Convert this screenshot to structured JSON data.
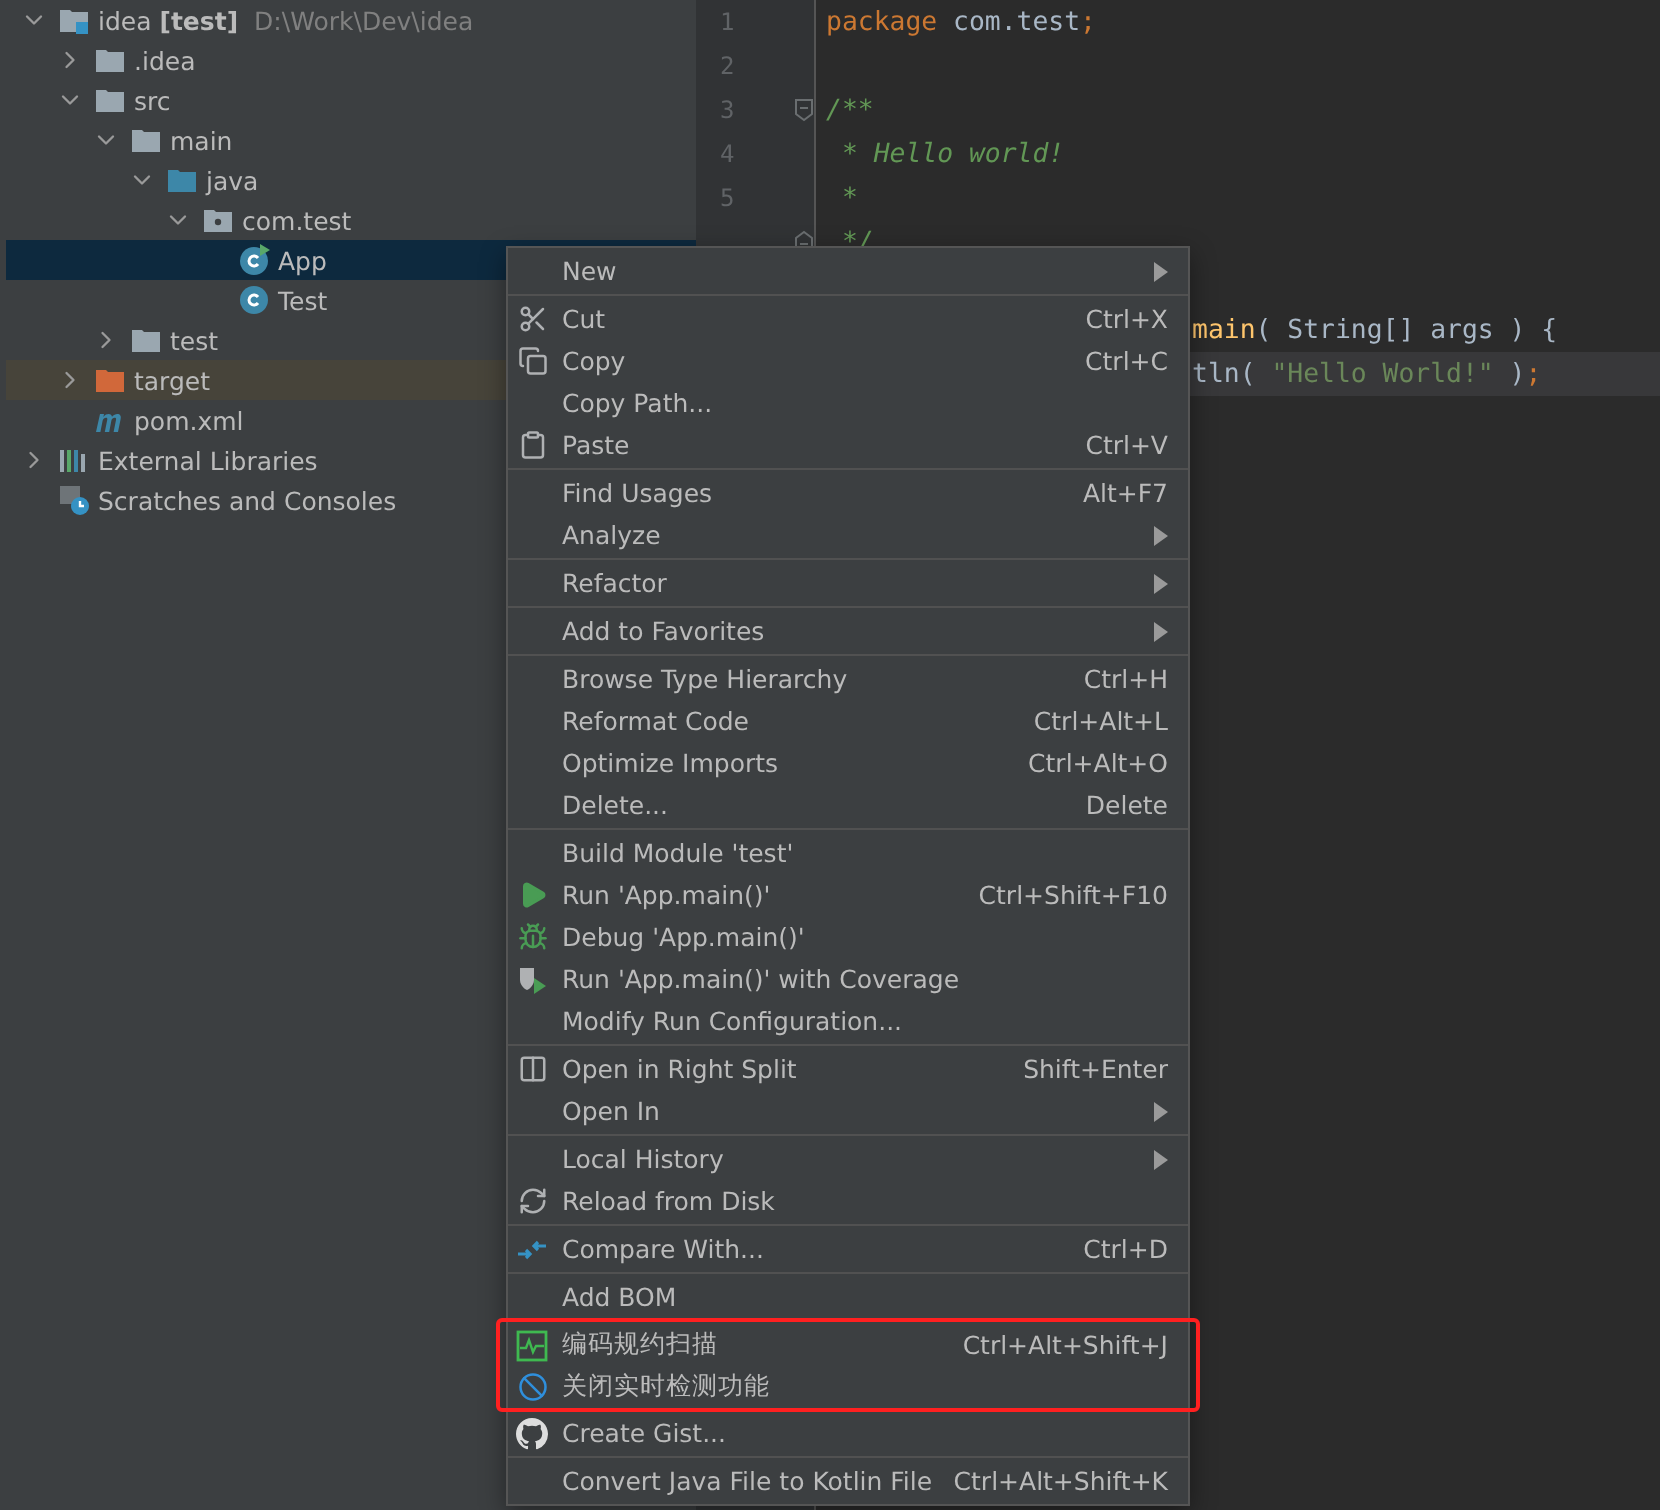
{
  "project_tree": [
    {
      "label": "idea **[test]**",
      "path": "D:\\Work\\Dev\\idea",
      "kind": "module",
      "expanded": true,
      "selected": false,
      "children": [
        {
          "label": ".idea",
          "kind": "folder",
          "expanded": false,
          "selected": false
        },
        {
          "label": "src",
          "kind": "folder",
          "expanded": true,
          "selected": false,
          "children": [
            {
              "label": "main",
              "kind": "folder",
              "expanded": true,
              "selected": false,
              "children": [
                {
                  "label": "java",
                  "kind": "source",
                  "expanded": true,
                  "selected": false,
                  "children": [
                    {
                      "label": "com.test",
                      "kind": "package",
                      "expanded": true,
                      "selected": false,
                      "children": [
                        {
                          "label": "App",
                          "kind": "main",
                          "selected": true
                        },
                        {
                          "label": "Test",
                          "kind": "class",
                          "selected": false
                        }
                      ]
                    }
                  ]
                }
              ]
            },
            {
              "label": "test",
              "kind": "folder",
              "expanded": false,
              "selected": false
            }
          ]
        },
        {
          "label": "target",
          "kind": "excluded",
          "expanded": false,
          "selected": false
        },
        {
          "label": "pom.xml",
          "kind": "maven",
          "selected": false
        }
      ]
    },
    {
      "label": "External Libraries",
      "kind": "libraries",
      "expanded": false,
      "selected": false
    },
    {
      "label": "Scratches and Consoles",
      "kind": "scratches",
      "selected": false
    }
  ],
  "editor": {
    "lines": [
      {
        "number": "1",
        "kind": "code",
        "current": false,
        "segments": [
          {
            "text": "package",
            "kind": "keyword"
          },
          {
            "text": " com.test",
            "kind": "plain"
          },
          {
            "text": ";",
            "kind": "keyword"
          }
        ]
      },
      {
        "number": "2",
        "kind": "blank",
        "current": false
      },
      {
        "number": "3",
        "kind": "foldstart",
        "current": false,
        "segments": [
          {
            "text": "/**",
            "kind": "doc"
          }
        ]
      },
      {
        "number": "4",
        "kind": "code",
        "current": false,
        "segments": [
          {
            "text": " * Hello world!",
            "kind": "doc"
          }
        ]
      },
      {
        "number": "5",
        "kind": "code",
        "current": false,
        "segments": [
          {
            "text": " *",
            "kind": "doc"
          }
        ]
      },
      {
        "kind": "foldend",
        "current": false,
        "segments": [
          {
            "text": " */",
            "kind": "doc"
          }
        ]
      },
      {
        "kind": "blank",
        "current": false
      },
      {
        "kind": "partial",
        "current": false,
        "segments": [
          {
            "text": "main",
            "kind": "method"
          },
          {
            "text": "( String[] args ) {",
            "kind": "plain"
          }
        ]
      },
      {
        "kind": "partial",
        "current": true,
        "segments": [
          {
            "text": "tln( ",
            "kind": "plain"
          },
          {
            "text": "\"Hello World!\"",
            "kind": "string"
          },
          {
            "text": " )",
            "kind": "plain"
          },
          {
            "text": ";",
            "kind": "keyword"
          }
        ]
      }
    ]
  },
  "context_menu": {
    "groups": [
      {
        "divider": false,
        "outlined": false,
        "items": [
          {
            "label": "New",
            "submenu": true
          }
        ]
      },
      {
        "divider": true,
        "outlined": false,
        "items": [
          {
            "label": "Cut",
            "kind": "scissors",
            "shortcut": "Ctrl+X",
            "submenu": false
          },
          {
            "label": "Copy",
            "kind": "copy",
            "shortcut": "Ctrl+C",
            "submenu": false
          },
          {
            "label": "Copy Path...",
            "submenu": false
          },
          {
            "label": "Paste",
            "kind": "clipboard",
            "shortcut": "Ctrl+V",
            "submenu": false
          }
        ]
      },
      {
        "divider": true,
        "outlined": false,
        "items": [
          {
            "label": "Find Usages",
            "shortcut": "Alt+F7",
            "submenu": false
          },
          {
            "label": "Analyze",
            "submenu": true
          }
        ]
      },
      {
        "divider": true,
        "outlined": false,
        "items": [
          {
            "label": "Refactor",
            "submenu": true
          }
        ]
      },
      {
        "divider": true,
        "outlined": false,
        "items": [
          {
            "label": "Add to Favorites",
            "submenu": true
          }
        ]
      },
      {
        "divider": true,
        "outlined": false,
        "items": [
          {
            "label": "Browse Type Hierarchy",
            "shortcut": "Ctrl+H",
            "submenu": false
          },
          {
            "label": "Reformat Code",
            "shortcut": "Ctrl+Alt+L",
            "submenu": false
          },
          {
            "label": "Optimize Imports",
            "shortcut": "Ctrl+Alt+O",
            "submenu": false
          },
          {
            "label": "Delete...",
            "shortcut": "Delete",
            "submenu": false
          }
        ]
      },
      {
        "divider": true,
        "outlined": false,
        "items": [
          {
            "label": "Build Module 'test'",
            "submenu": false
          },
          {
            "label": "Run 'App.main()'",
            "kind": "run",
            "shortcut": "Ctrl+Shift+F10",
            "submenu": false
          },
          {
            "label": "Debug 'App.main()'",
            "kind": "debug",
            "submenu": false
          },
          {
            "label": "Run 'App.main()' with Coverage",
            "kind": "coverage",
            "submenu": false
          },
          {
            "label": "Modify Run Configuration...",
            "submenu": false
          }
        ]
      },
      {
        "divider": true,
        "outlined": false,
        "items": [
          {
            "label": "Open in Right Split",
            "kind": "split",
            "shortcut": "Shift+Enter",
            "submenu": false
          },
          {
            "label": "Open In",
            "submenu": true
          }
        ]
      },
      {
        "divider": true,
        "outlined": false,
        "items": [
          {
            "label": "Local History",
            "submenu": true
          },
          {
            "label": "Reload from Disk",
            "kind": "reload",
            "submenu": false
          }
        ]
      },
      {
        "divider": true,
        "outlined": false,
        "items": [
          {
            "label": "Compare With...",
            "kind": "compare",
            "shortcut": "Ctrl+D",
            "submenu": false
          }
        ]
      },
      {
        "divider": true,
        "outlined": false,
        "items": [
          {
            "label": "Add BOM",
            "submenu": false
          }
        ]
      },
      {
        "divider": true,
        "outlined": true,
        "items": [
          {
            "label": "编码规约扫描",
            "kind": "scan",
            "shortcut": "Ctrl+Alt+Shift+J",
            "submenu": false
          },
          {
            "label": "关闭实时检测功能",
            "kind": "forbidden",
            "submenu": false
          }
        ]
      },
      {
        "divider": false,
        "outlined": false,
        "items": [
          {
            "label": "Create Gist...",
            "kind": "github",
            "submenu": false
          }
        ]
      },
      {
        "divider": true,
        "outlined": false,
        "items": [
          {
            "label": "Convert Java File to Kotlin File",
            "shortcut": "Ctrl+Alt+Shift+K",
            "submenu": false
          }
        ]
      }
    ]
  }
}
